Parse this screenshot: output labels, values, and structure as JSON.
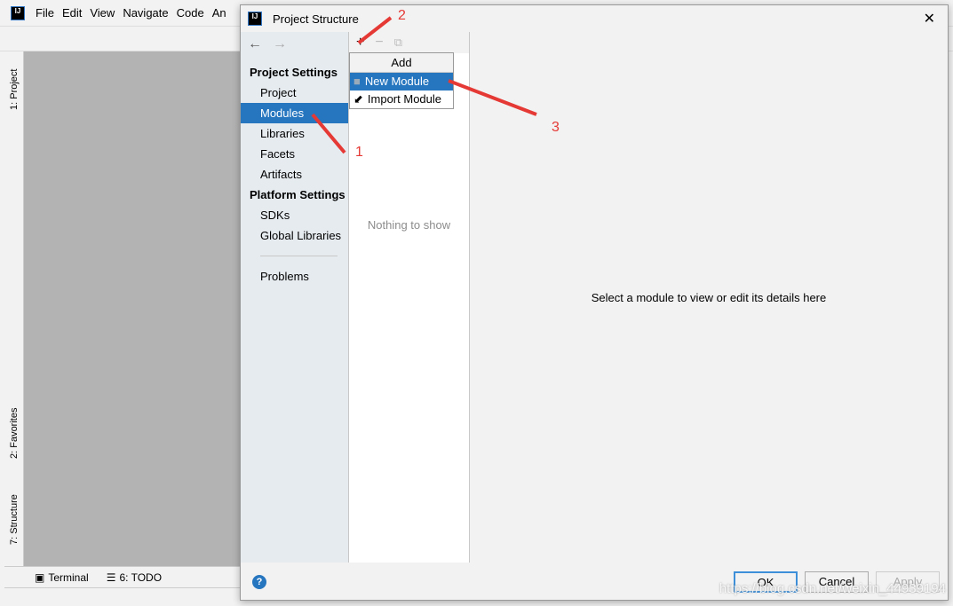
{
  "ide": {
    "menu": [
      "File",
      "Edit",
      "View",
      "Navigate",
      "Code",
      "An"
    ],
    "side_tabs": [
      "1: Project",
      "2: Favorites",
      "7: Structure"
    ],
    "bottom_tabs": [
      "Terminal",
      "6: TODO"
    ]
  },
  "dialog": {
    "title": "Project Structure",
    "nav": {
      "section1": "Project Settings",
      "items1": [
        "Project",
        "Modules",
        "Libraries",
        "Facets",
        "Artifacts"
      ],
      "section2": "Platform Settings",
      "items2": [
        "SDKs",
        "Global Libraries"
      ],
      "problems": "Problems",
      "selected": "Modules"
    },
    "list_empty": "Nothing to show",
    "popup": {
      "header": "Add",
      "items": [
        "New Module",
        "Import Module"
      ]
    },
    "detail_text": "Select a module to view or edit its details here",
    "buttons": {
      "ok": "OK",
      "cancel": "Cancel",
      "apply": "Apply"
    }
  },
  "annotations": [
    "1",
    "2",
    "3"
  ],
  "watermark": "https://blog.csdn.net/weixin_44939194"
}
